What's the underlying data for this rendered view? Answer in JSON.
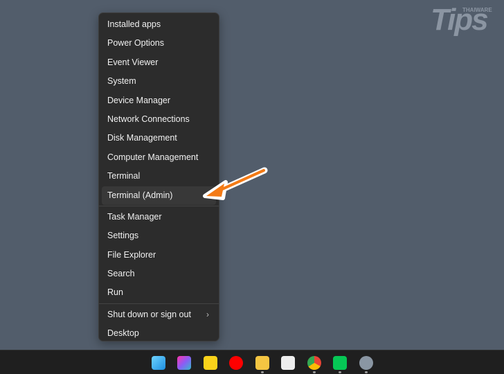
{
  "menu": {
    "items": [
      "Installed apps",
      "Power Options",
      "Event Viewer",
      "System",
      "Device Manager",
      "Network Connections",
      "Disk Management",
      "Computer Management",
      "Terminal",
      "Terminal (Admin)",
      "Task Manager",
      "Settings",
      "File Explorer",
      "Search",
      "Run",
      "Shut down or sign out",
      "Desktop"
    ]
  },
  "logo": {
    "text": "Tips",
    "sub": "THAIWARE"
  },
  "taskbar": {
    "icons": [
      "windows-start-icon",
      "copilot-icon",
      "sticky-notes-icon",
      "youtube-music-icon",
      "file-explorer-icon",
      "app-icon",
      "chrome-icon",
      "line-icon",
      "settings-icon"
    ]
  },
  "colors": {
    "arrow": "#f47b16",
    "background": "#525d6b"
  }
}
